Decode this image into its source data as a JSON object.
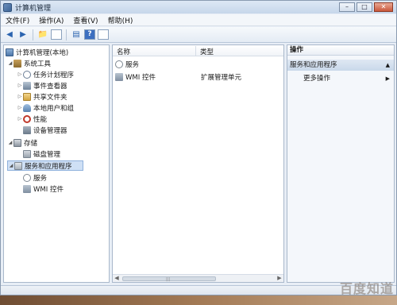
{
  "window": {
    "title": "计算机管理"
  },
  "menu": [
    "文件(F)",
    "操作(A)",
    "查看(V)",
    "帮助(H)"
  ],
  "tree": {
    "root": "计算机管理(本地)",
    "system_tools": "系统工具",
    "task_scheduler": "任务计划程序",
    "event_viewer": "事件查看器",
    "shared_folders": "共享文件夹",
    "local_users": "本地用户和组",
    "performance": "性能",
    "device_manager": "设备管理器",
    "storage": "存储",
    "disk_management": "磁盘管理",
    "services_apps": "服务和应用程序",
    "services": "服务",
    "wmi": "WMI 控件"
  },
  "list": {
    "col_name": "名称",
    "col_type": "类型",
    "rows": [
      {
        "name": "服务",
        "type": ""
      },
      {
        "name": "WMI 控件",
        "type": "扩展管理单元"
      }
    ]
  },
  "actions": {
    "header": "操作",
    "section": "服务和应用程序",
    "more": "更多操作"
  },
  "watermark": "百度知道"
}
